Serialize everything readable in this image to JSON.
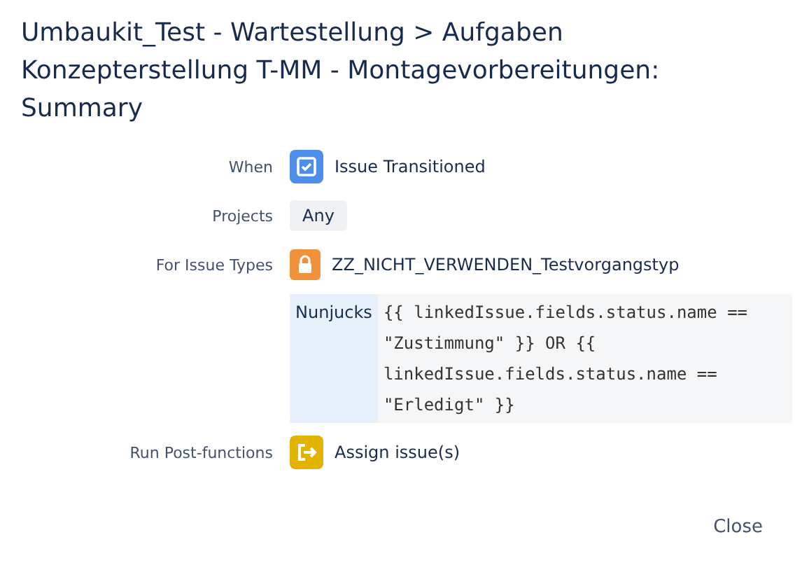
{
  "dialog": {
    "title": "Umbaukit_Test - Wartestellung > Aufgaben Konzepterstellung T-MM - Montagevorbereitungen: Summary"
  },
  "rows": [
    {
      "kind": "trigger",
      "label": "When",
      "value": "Issue Transitioned"
    },
    {
      "kind": "tag",
      "label": "Projects",
      "value": "Any"
    },
    {
      "kind": "issue-type",
      "label": "For Issue Types",
      "value": "ZZ_NICHT_VERWENDEN_Testvorgangstyp"
    },
    {
      "kind": "condition",
      "label": "",
      "lang": "Nunjucks",
      "value": "{{ linkedIssue.fields.status.name == \"Zustimmung\" }} OR {{ linkedIssue.fields.status.name == \"Erledigt\" }}"
    },
    {
      "kind": "action",
      "label": "Run Post-functions",
      "value": "Assign issue(s)"
    }
  ],
  "close_button": "Close"
}
